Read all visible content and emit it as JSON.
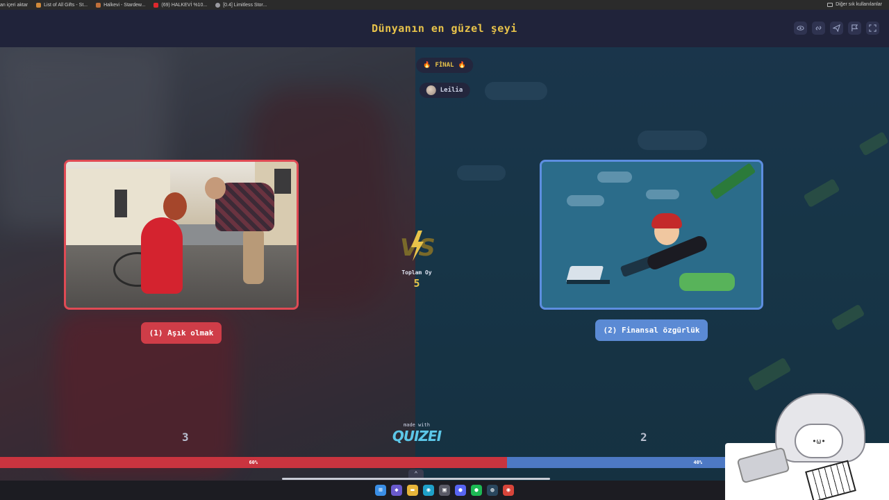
{
  "browser": {
    "bookmarks": [
      {
        "label": "an içeri aktar",
        "color": "#888888"
      },
      {
        "label": "List of All Gifts - St...",
        "color": "#d08a3a"
      },
      {
        "label": "Halkevi - Stardew...",
        "color": "#c0703a"
      },
      {
        "label": "(69) HALKEVİ %10...",
        "color": "#e0282d"
      },
      {
        "label": "[0.4] Limitless Stor...",
        "color": "#9a9aa0"
      }
    ],
    "other_bookmarks": "Diğer sık kullanılanlar"
  },
  "header": {
    "title": "Dünyanın en güzel şeyi",
    "icons": [
      "eye-icon",
      "link-icon",
      "send-icon",
      "flag-icon",
      "fullscreen-icon"
    ]
  },
  "match": {
    "round_label": "FİNAL",
    "user_name": "Leilia",
    "vs_label": "VS",
    "total_label": "Toplam Oy",
    "total_votes": "5"
  },
  "left": {
    "label": "(1) Aşık olmak",
    "votes": "3",
    "percent_text": "60%",
    "share": 0.6,
    "accent": "#cf3d48"
  },
  "right": {
    "label": "(2) Finansal özgürlük",
    "votes": "2",
    "percent_text": "40%",
    "share": 0.4,
    "accent": "#5b8ad4"
  },
  "footer": {
    "made_with": "made with",
    "brand": "QUIZEI"
  },
  "taskbar": {
    "apps": [
      {
        "name": "start-icon",
        "glyph": "⊞",
        "color": "#3a8ee6"
      },
      {
        "name": "copilot-icon",
        "glyph": "◆",
        "color": "#6a5acd"
      },
      {
        "name": "folder-icon",
        "glyph": "▬",
        "color": "#e6b43a"
      },
      {
        "name": "edge-icon",
        "glyph": "◉",
        "color": "#1fa0c8"
      },
      {
        "name": "store-icon",
        "glyph": "▣",
        "color": "#5a5a66"
      },
      {
        "name": "discord-icon",
        "glyph": "●",
        "color": "#5865f2"
      },
      {
        "name": "spotify-icon",
        "glyph": "●",
        "color": "#1db954"
      },
      {
        "name": "steam-icon",
        "glyph": "◍",
        "color": "#2a475e"
      },
      {
        "name": "chrome-icon",
        "glyph": "◉",
        "color": "#d8453a"
      }
    ]
  }
}
